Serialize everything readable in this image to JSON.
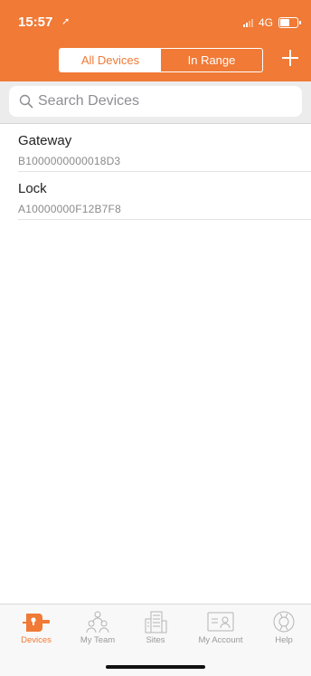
{
  "colors": {
    "accent": "#f07a36"
  },
  "status_bar": {
    "time": "15:57",
    "location_arrow": "➚",
    "network": "4G"
  },
  "header": {
    "segments": [
      {
        "label": "All Devices",
        "selected": true
      },
      {
        "label": "In Range",
        "selected": false
      }
    ],
    "add_icon": "plus-icon"
  },
  "search": {
    "placeholder": "Search Devices",
    "value": ""
  },
  "devices": [
    {
      "name": "Gateway",
      "serial": "B1000000000018D3"
    },
    {
      "name": "Lock",
      "serial": "A10000000F12B7F8"
    }
  ],
  "tab_bar": {
    "tabs": [
      {
        "label": "Devices",
        "icon": "devices-icon",
        "active": true
      },
      {
        "label": "My Team",
        "icon": "team-icon",
        "active": false
      },
      {
        "label": "Sites",
        "icon": "building-icon",
        "active": false
      },
      {
        "label": "My Account",
        "icon": "account-card-icon",
        "active": false
      },
      {
        "label": "Help",
        "icon": "lifebuoy-icon",
        "active": false
      }
    ]
  }
}
